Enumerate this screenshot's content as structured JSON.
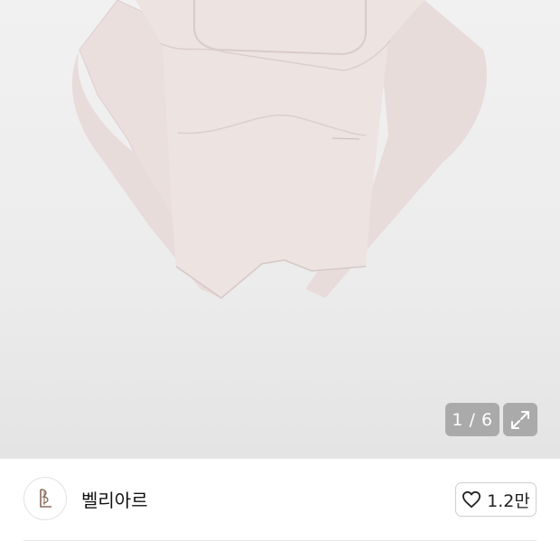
{
  "gallery": {
    "counter_text": "1 / 6",
    "expand_icon": "expand-icon"
  },
  "shop": {
    "name": "벨리아르",
    "avatar_icon": "shop-logo",
    "like_icon": "heart-icon",
    "like_count": "1.2만"
  }
}
